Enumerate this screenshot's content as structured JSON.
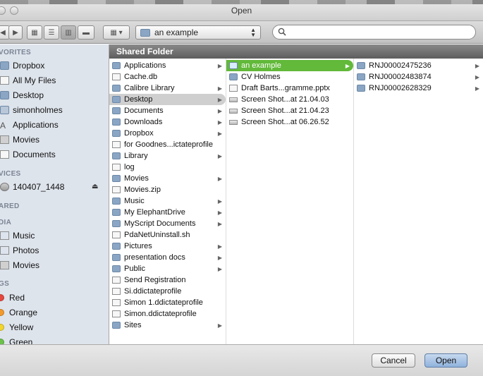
{
  "window": {
    "title": "Open"
  },
  "toolbar": {
    "path": "an example",
    "search_placeholder": ""
  },
  "sidebar": {
    "favorites_heading": "VORITES",
    "favorites": [
      {
        "label": "Dropbox",
        "icon": "dropbox-folder-icon"
      },
      {
        "label": "All My Files",
        "icon": "all-files-icon"
      },
      {
        "label": "Desktop",
        "icon": "desktop-icon"
      },
      {
        "label": "simonholmes",
        "icon": "home-icon"
      },
      {
        "label": "Applications",
        "icon": "applications-icon"
      },
      {
        "label": "Movies",
        "icon": "movies-icon"
      },
      {
        "label": "Documents",
        "icon": "documents-icon"
      }
    ],
    "devices_heading": "VICES",
    "devices": [
      {
        "label": "140407_1448",
        "icon": "disk-icon"
      }
    ],
    "shared_heading": "ARED",
    "media_heading": "DIA",
    "media": [
      {
        "label": "Music",
        "icon": "music-icon"
      },
      {
        "label": "Photos",
        "icon": "photos-icon"
      },
      {
        "label": "Movies",
        "icon": "movies-icon"
      }
    ],
    "tags_heading": "GS",
    "tags": [
      {
        "label": "Red",
        "color": "#e5483f"
      },
      {
        "label": "Orange",
        "color": "#f29a2e"
      },
      {
        "label": "Yellow",
        "color": "#f2d52e"
      },
      {
        "label": "Green",
        "color": "#6bc24a"
      }
    ]
  },
  "browser": {
    "header": "Shared Folder",
    "col1": [
      {
        "label": "Applications",
        "type": "folder",
        "chevron": true
      },
      {
        "label": "Cache.db",
        "type": "file",
        "chevron": false
      },
      {
        "label": "Calibre Library",
        "type": "folder",
        "chevron": true
      },
      {
        "label": "Desktop",
        "type": "folder",
        "chevron": true,
        "selected": true
      },
      {
        "label": "Documents",
        "type": "folder",
        "chevron": true
      },
      {
        "label": "Downloads",
        "type": "folder",
        "chevron": true
      },
      {
        "label": "Dropbox",
        "type": "folder",
        "chevron": true
      },
      {
        "label": "for Goodnes...ictateprofile",
        "type": "file",
        "chevron": false
      },
      {
        "label": "Library",
        "type": "folder",
        "chevron": true
      },
      {
        "label": "log",
        "type": "file",
        "chevron": false
      },
      {
        "label": "Movies",
        "type": "folder",
        "chevron": true
      },
      {
        "label": "Movies.zip",
        "type": "file",
        "chevron": false
      },
      {
        "label": "Music",
        "type": "folder",
        "chevron": true
      },
      {
        "label": "My ElephantDrive",
        "type": "folder",
        "chevron": true
      },
      {
        "label": "MyScript Documents",
        "type": "folder",
        "chevron": true
      },
      {
        "label": "PdaNetUninstall.sh",
        "type": "file",
        "chevron": false
      },
      {
        "label": "Pictures",
        "type": "folder",
        "chevron": true
      },
      {
        "label": "presentation docs",
        "type": "folder",
        "chevron": true
      },
      {
        "label": "Public",
        "type": "folder",
        "chevron": true
      },
      {
        "label": "Send Registration",
        "type": "file",
        "chevron": false
      },
      {
        "label": "Si.ddictateprofile",
        "type": "file",
        "chevron": false
      },
      {
        "label": "Simon 1.ddictateprofile",
        "type": "file",
        "chevron": false
      },
      {
        "label": "Simon.ddictateprofile",
        "type": "file",
        "chevron": false
      },
      {
        "label": "Sites",
        "type": "folder",
        "chevron": true
      }
    ],
    "col2": [
      {
        "label": "an example",
        "type": "folder",
        "chevron": true,
        "selected": true
      },
      {
        "label": "CV Holmes",
        "type": "folder",
        "chevron": false
      },
      {
        "label": "Draft Barts...gramme.pptx",
        "type": "file",
        "chevron": false
      },
      {
        "label": "Screen Shot...at 21.04.03",
        "type": "shot",
        "chevron": false
      },
      {
        "label": "Screen Shot...at 21.04.23",
        "type": "shot",
        "chevron": false
      },
      {
        "label": "Screen Shot...at 06.26.52",
        "type": "shot",
        "chevron": false
      }
    ],
    "col3": [
      {
        "label": "RNJ00002475236",
        "type": "folder",
        "chevron": true
      },
      {
        "label": "RNJ00002483874",
        "type": "folder",
        "chevron": true
      },
      {
        "label": "RNJ00002628329",
        "type": "folder",
        "chevron": true
      }
    ]
  },
  "footer": {
    "cancel_label": "Cancel",
    "open_label": "Open"
  }
}
